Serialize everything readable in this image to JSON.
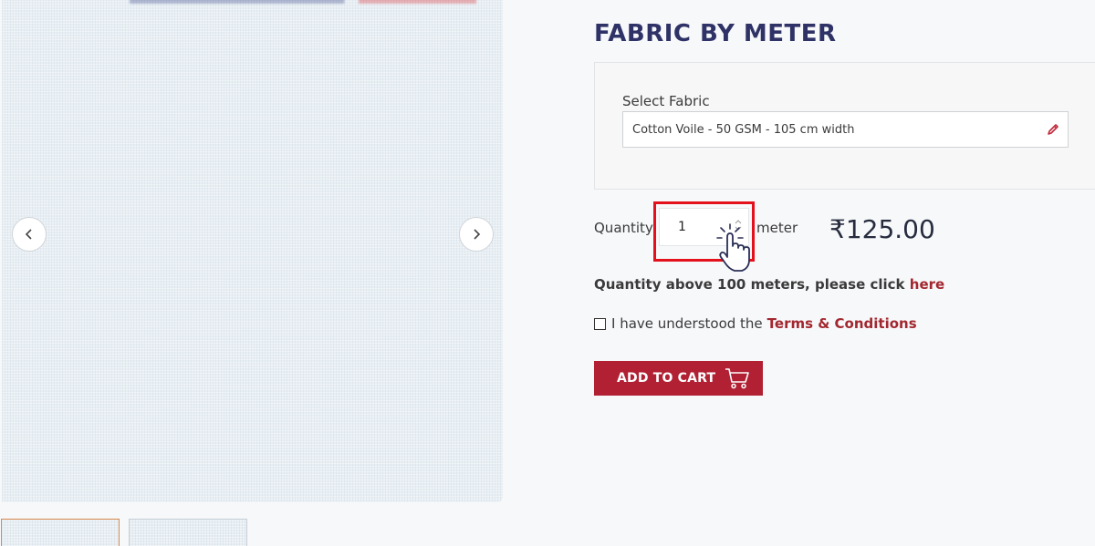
{
  "product": {
    "title": "FABRIC BY METER",
    "fabric_select": {
      "label": "Select Fabric",
      "value": "Cotton Voile - 50 GSM - 105 cm width"
    },
    "quantity": {
      "label": "Quantity",
      "value": "1",
      "unit": "meter"
    },
    "price": "₹125.00",
    "bulk_note": {
      "text": "Quantity above 100 meters, please click",
      "link": "here"
    },
    "terms": {
      "text": "I have understood the",
      "link": "Terms & Conditions"
    },
    "add_to_cart_label": "ADD TO CART"
  },
  "colors": {
    "title": "#2f3266",
    "accent": "#b12033",
    "link": "#a3272f",
    "highlight": "#e3111b"
  },
  "icons": [
    "chevron-left-icon",
    "chevron-right-icon",
    "pencil-icon",
    "spin-arrows-icon",
    "pointer-hand-icon",
    "cart-icon"
  ]
}
